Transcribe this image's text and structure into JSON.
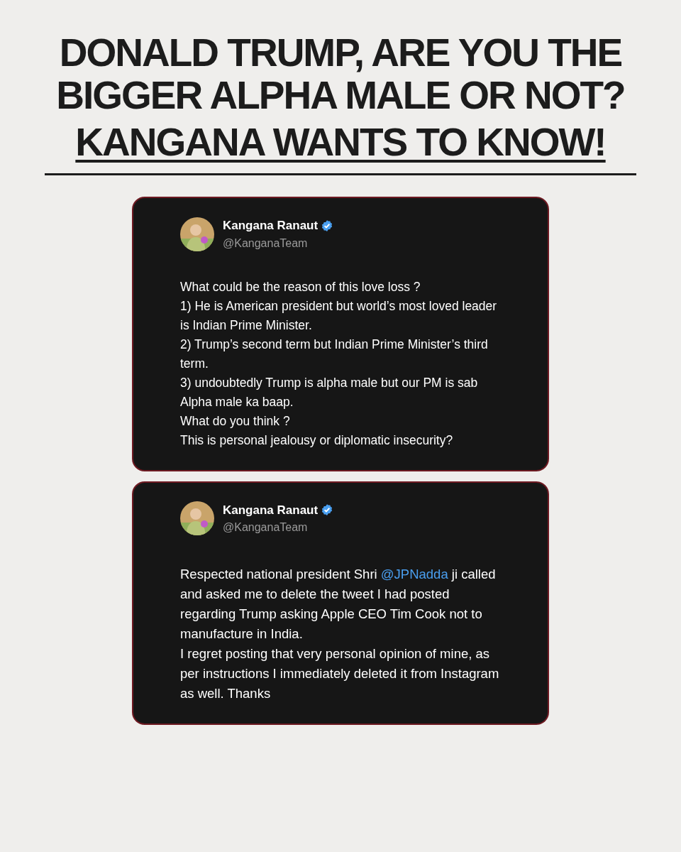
{
  "headline": {
    "lines": [
      "DONALD TRUMP, ARE YOU THE",
      "BIGGER ALPHA MALE OR NOT?"
    ],
    "emphasis": "KANGANA WANTS TO KNOW!"
  },
  "tweets": [
    {
      "name": "Kangana Ranaut",
      "verified": true,
      "handle": "@KanganaTeam",
      "paragraphs": [
        [
          {
            "kind": "text",
            "text": "What could be the reason of this love loss ?"
          }
        ],
        [
          {
            "kind": "text",
            "text": "1) He is American president but world’s most loved leader is Indian Prime Minister."
          }
        ],
        [
          {
            "kind": "text",
            "text": "2) Trump’s second term but Indian Prime Minister’s third term."
          }
        ],
        [
          {
            "kind": "text",
            "text": "3) undoubtedly Trump is alpha male but our PM is sab Alpha male ka baap."
          }
        ],
        [
          {
            "kind": "text",
            "text": "What do you think ?"
          }
        ],
        [
          {
            "kind": "text",
            "text": "This is personal jealousy or diplomatic insecurity?"
          }
        ]
      ]
    },
    {
      "name": "Kangana Ranaut",
      "verified": true,
      "handle": "@KanganaTeam",
      "paragraphs": [
        [
          {
            "kind": "text",
            "text": "Respected national president Shri "
          },
          {
            "kind": "mention",
            "text": "@JPNadda"
          },
          {
            "kind": "text",
            "text": " ji called and asked me to delete the tweet I had posted regarding Trump asking  Apple CEO Tim Cook not to manufacture in India."
          }
        ],
        [
          {
            "kind": "text",
            "text": "I regret posting that very personal opinion of mine, as per instructions I immediately deleted it from Instagram as well. Thanks"
          }
        ]
      ]
    }
  ]
}
